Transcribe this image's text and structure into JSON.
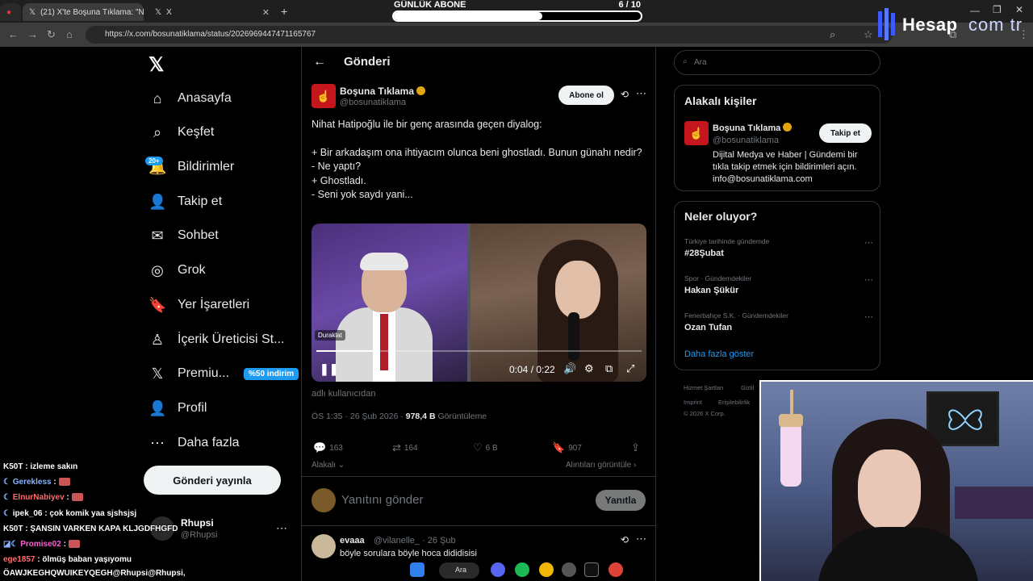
{
  "browser": {
    "tabs": [
      {
        "title": "(21) X'te Boşuna Tıklama: \"N"
      },
      {
        "title": "X"
      }
    ],
    "url": "https://x.com/bosunatiklama/status/2026969447471165767"
  },
  "overlay": {
    "goal_label": "GÜNLÜK ABONE",
    "goal_count": "6 / 10",
    "goal_fraction": 0.6,
    "brand_left": "Hesap",
    "brand_right": "com tr"
  },
  "nav": {
    "items": [
      {
        "label": "Anasayfa",
        "icon": "home-icon"
      },
      {
        "label": "Keşfet",
        "icon": "search-icon"
      },
      {
        "label": "Bildirimler",
        "icon": "bell-icon"
      },
      {
        "label": "Takip et",
        "icon": "person-add-icon"
      },
      {
        "label": "Sohbet",
        "icon": "mail-icon"
      },
      {
        "label": "Grok",
        "icon": "grok-icon"
      },
      {
        "label": "Yer İşaretleri",
        "icon": "bookmark-icon"
      },
      {
        "label": "İçerik Üreticisi St...",
        "icon": "creator-icon"
      },
      {
        "label": "Premiu...",
        "icon": "x-premium-icon"
      },
      {
        "label": "Profil",
        "icon": "profile-icon"
      },
      {
        "label": "Daha fazla",
        "icon": "more-circle-icon"
      }
    ],
    "notif_badge": "20+",
    "premium_promo": "%50 indirim",
    "post_button": "Gönderi yayınla",
    "account_name": "Rhupsi",
    "account_handle": "@Rhupsi"
  },
  "chat": [
    {
      "user": "K50T",
      "msg": ": izleme sakın"
    },
    {
      "user": "Gerekless",
      "msg": ":"
    },
    {
      "user": "ElnurNabiyev",
      "msg": ":"
    },
    {
      "user": "ipek_06",
      "msg": ": çok komik yaa sjshsjsj"
    },
    {
      "user": "K50T",
      "msg": ": ŞANSIN VARKEN KAPA KLJGDFHGFD"
    },
    {
      "user": "Promise02",
      "msg": ":"
    },
    {
      "user": "ege1857",
      "msg": ": ölmüş baban yaşıyomu"
    },
    {
      "user": "",
      "msg": "ÖAWJKEGHQWUIKEYQEGH@Rhupsi@Rhupsi,"
    }
  ],
  "main": {
    "header_title": "Gönderi",
    "author_name": "Boşuna Tıklama",
    "author_handle": "@bosunatiklama",
    "subscribe_label": "Abone ol",
    "tweet_lines": [
      "Nihat Hatipoğlu ile bir genç arasında geçen diyalog:",
      "",
      "+ Bir arkadaşım ona ihtiyacım olunca beni ghostladı. Bunun günahı nedir?",
      "- Ne yaptı?",
      "+ Ghostladı.",
      "- Seni yok saydı yani..."
    ],
    "video": {
      "paused_label": "Duraklat",
      "time": "0:04 / 0:22",
      "progress": 0.18
    },
    "from_user": "adlı kullanıcıdan",
    "meta_time": "ÖS 1:35 · 26 Şub 2026 ·",
    "meta_views": "978,4 B",
    "meta_views_label": "Görüntüleme",
    "actions": {
      "replies": "163",
      "reposts": "164",
      "likes": "6 B",
      "bookmarks": "907"
    },
    "relevant_label": "Alakalı",
    "quotes_label": "Alıntıları görüntüle",
    "reply_placeholder": "Yanıtını gönder",
    "reply_button": "Yanıtla",
    "first_reply": {
      "name": "evaaa",
      "handle": "@vilanelle_ · 26 Şub",
      "text": "böyle sorulara böyle hoca dididisisi"
    }
  },
  "right": {
    "search_placeholder": "Ara",
    "related_title": "Alakalı kişiler",
    "related_name": "Boşuna Tıklama",
    "related_handle": "@bosunatiklama",
    "related_follow": "Takip et",
    "related_bio": "Dijital Medya ve Haber | Gündemi bir tıkla takip etmek için bildirimleri açın. info@bosunatiklama.com",
    "trends_title": "Neler oluyor?",
    "trends": [
      {
        "context": "Türkiye tarihinde gündemde",
        "title": "#28Şubat"
      },
      {
        "context": "Spor · Gündemdekiler",
        "title": "Hakan Şükür"
      },
      {
        "context": "Fenerbahçe S.K. · Gündemdekiler",
        "title": "Ozan Tufan"
      }
    ],
    "show_more": "Daha fazla göster",
    "footer": [
      "Hizmet Şartları",
      "Gizlil",
      "Imprint",
      "Erişilebilirlik",
      "© 2026 X Corp."
    ]
  },
  "taskbar": {
    "search_label": "Ara"
  },
  "colors": {
    "accent": "#1d9bf0",
    "brand_red": "#c4161c",
    "background": "#000000"
  }
}
